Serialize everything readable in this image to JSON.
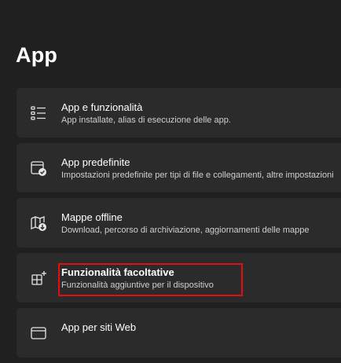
{
  "page": {
    "title": "App"
  },
  "items": [
    {
      "icon": "list-icon",
      "title": "App e funzionalità",
      "subtitle": "App installate, alias di esecuzione delle app."
    },
    {
      "icon": "default-apps-icon",
      "title": "App predefinite",
      "subtitle": "Impostazioni predefinite per tipi di file e collegamenti, altre impostazioni"
    },
    {
      "icon": "map-download-icon",
      "title": "Mappe offline",
      "subtitle": "Download, percorso di archiviazione, aggiornamenti delle mappe"
    },
    {
      "icon": "optional-features-icon",
      "title": "Funzionalità facoltative",
      "subtitle": "Funzionalità aggiuntive per il dispositivo"
    },
    {
      "icon": "web-apps-icon",
      "title": "App per siti Web",
      "subtitle": ""
    }
  ],
  "highlight_color": "#e01010"
}
